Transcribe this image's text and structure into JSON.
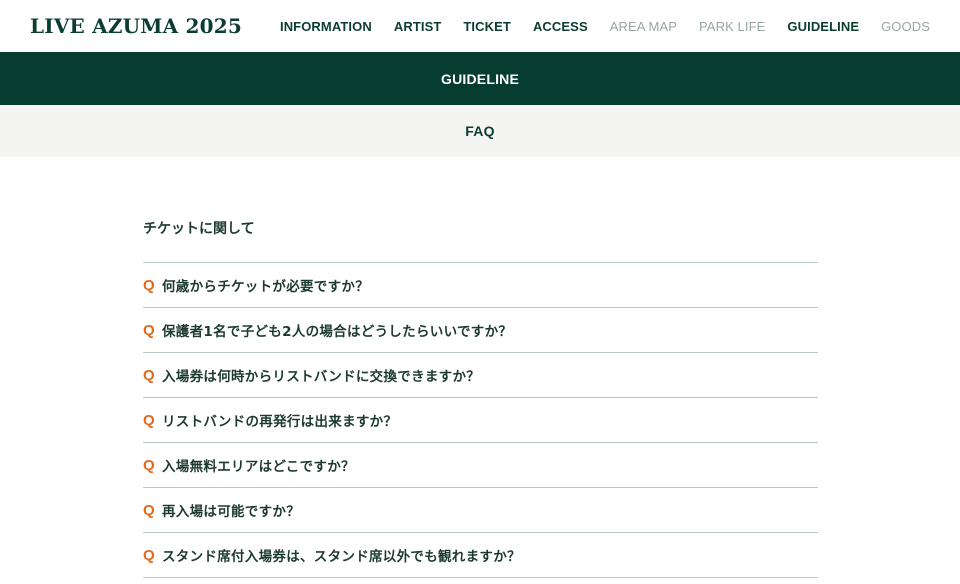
{
  "header": {
    "logo": "LIVE AZUMA 2025",
    "nav": [
      {
        "label": "INFORMATION",
        "active": true
      },
      {
        "label": "ARTIST",
        "active": true
      },
      {
        "label": "TICKET",
        "active": true
      },
      {
        "label": "ACCESS",
        "active": true
      },
      {
        "label": "AREA MAP",
        "active": false
      },
      {
        "label": "PARK LIFE",
        "active": false
      },
      {
        "label": "GUIDELINE",
        "active": true
      },
      {
        "label": "GOODS",
        "active": false
      }
    ]
  },
  "banner": {
    "title": "GUIDELINE"
  },
  "subbar": {
    "title": "FAQ"
  },
  "faq": {
    "section_title": "チケットに関して",
    "q_label": "Q",
    "questions": [
      "何歳からチケットが必要ですか？",
      "保護者1名で子ども2人の場合はどうしたらいいですか？",
      "入場券は何時からリストバンドに交換できますか？",
      "リストバンドの再発行は出来ますか？",
      "入場無料エリアはどこですか？",
      "再入場は可能ですか？",
      "スタンド席付入場券は、スタンド席以外でも観れますか？"
    ]
  },
  "colors": {
    "brand_green": "#073d31",
    "q_accent": "#e06a1b",
    "nav_dim": "#9aa6a2"
  }
}
